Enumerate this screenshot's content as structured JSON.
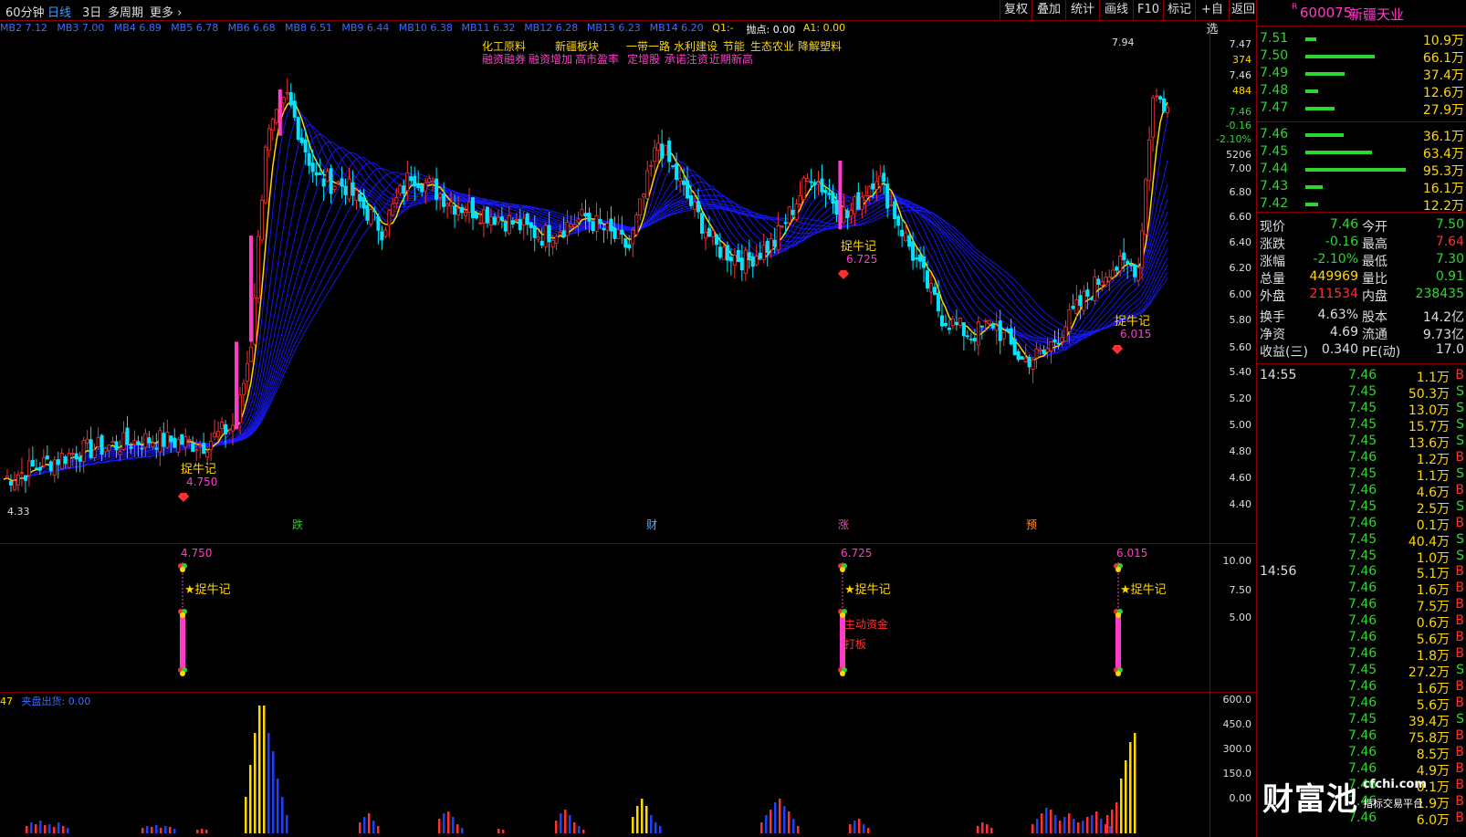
{
  "toolbar": {
    "period": "60分钟",
    "day": "日线",
    "three_day": "3日",
    "multi": "多周期",
    "more": "更多",
    "buttons": [
      "复权",
      "叠加",
      "统计",
      "画线",
      "F10",
      "标记",
      "+自选",
      "返回"
    ]
  },
  "stock": {
    "badge": "R",
    "code": "600075",
    "name": "新疆天业"
  },
  "ma_legend": [
    {
      "label": "MB2 7.12",
      "color": "#3a6cff"
    },
    {
      "label": "MB3 7.00",
      "color": "#3a6cff"
    },
    {
      "label": "MB4 6.89",
      "color": "#3a6cff"
    },
    {
      "label": "MB5 6.78",
      "color": "#3a6cff"
    },
    {
      "label": "MB6 6.68",
      "color": "#3a6cff"
    },
    {
      "label": "MB8 6.51",
      "color": "#3a6cff"
    },
    {
      "label": "MB9 6.44",
      "color": "#3a6cff"
    },
    {
      "label": "MB10 6.38",
      "color": "#3a6cff"
    },
    {
      "label": "MB11 6.32",
      "color": "#3a6cff"
    },
    {
      "label": "MB12 6.28",
      "color": "#3a6cff"
    },
    {
      "label": "MB13 6.23",
      "color": "#3a6cff"
    },
    {
      "label": "MB14 6.20",
      "color": "#3a6cff"
    },
    {
      "label": "Q1:-",
      "color": "#ffd700"
    },
    {
      "label": "抛点: 0.00",
      "color": "#ffffff"
    },
    {
      "label": "A1: 0.00",
      "color": "#ffd700"
    }
  ],
  "concepts": {
    "line1": [
      "化工原料",
      "新疆板块",
      "一带一路",
      "水利建设",
      "节能",
      "生态农业",
      "降解塑料"
    ],
    "line2": [
      "融资融券",
      "融资增加",
      "高市盈率",
      "定增股",
      "承诺注资",
      "近期新高"
    ]
  },
  "price_axis": [
    "7.47",
    "374",
    "7.46",
    "484",
    "7.46",
    "-0.16",
    "-2.10%",
    "5206",
    "7.00",
    "6.80",
    "6.60",
    "6.40",
    "6.20",
    "6.00",
    "5.80",
    "5.60",
    "5.40",
    "5.20",
    "5.00",
    "4.80",
    "4.60",
    "4.40"
  ],
  "chart_data": {
    "type": "candlestick",
    "ylim": [
      4.2,
      8.0
    ],
    "high_label": "7.94",
    "low_label": "4.33",
    "signals": [
      {
        "text": "捉牛记",
        "value": "4.750"
      },
      {
        "text": "捉牛记",
        "value": "6.725"
      },
      {
        "text": "捉牛记",
        "value": "6.015"
      }
    ],
    "event_markers": [
      "跌",
      "财",
      "涨",
      "预"
    ],
    "indicator_axis": [
      "10.00",
      "7.50",
      "5.00"
    ],
    "indicator_labels": [
      {
        "value": "4.750",
        "text": "★捉牛记"
      },
      {
        "value": "6.725",
        "text": "★捉牛记",
        "extra": [
          "主动资金",
          "打板"
        ]
      },
      {
        "value": "6.015",
        "text": "★捉牛记"
      }
    ],
    "volume_axis": [
      "600.0",
      "450.0",
      "300.0",
      "150.0",
      "0.00"
    ],
    "volume_legend": {
      "prefix": "47",
      "label": "夹盘出货: 0.00"
    }
  },
  "orderbook": [
    {
      "price": "7.51",
      "vol": "10.9万",
      "bar": 0.11
    },
    {
      "price": "7.50",
      "vol": "66.1万",
      "bar": 0.69
    },
    {
      "price": "7.49",
      "vol": "37.4万",
      "bar": 0.39
    },
    {
      "price": "7.48",
      "vol": "12.6万",
      "bar": 0.13
    },
    {
      "price": "7.47",
      "vol": "27.9万",
      "bar": 0.29
    },
    {
      "price": "7.46",
      "vol": "36.1万",
      "bar": 0.38
    },
    {
      "price": "7.45",
      "vol": "63.4万",
      "bar": 0.66
    },
    {
      "price": "7.44",
      "vol": "95.3万",
      "bar": 1.0
    },
    {
      "price": "7.43",
      "vol": "16.1万",
      "bar": 0.17
    },
    {
      "price": "7.42",
      "vol": "12.2万",
      "bar": 0.13
    }
  ],
  "quote": [
    {
      "l": "现价",
      "v": "7.46",
      "c": "#2fd62f",
      "l2": "今开",
      "v2": "7.50",
      "c2": "#2fd62f"
    },
    {
      "l": "涨跌",
      "v": "-0.16",
      "c": "#2fd62f",
      "l2": "最高",
      "v2": "7.64",
      "c2": "#ff3030"
    },
    {
      "l": "涨幅",
      "v": "-2.10%",
      "c": "#2fd62f",
      "l2": "最低",
      "v2": "7.30",
      "c2": "#2fd62f"
    },
    {
      "l": "总量",
      "v": "449969",
      "c": "#ffd700",
      "l2": "量比",
      "v2": "0.91",
      "c2": "#2fd62f"
    },
    {
      "l": "外盘",
      "v": "211534",
      "c": "#ff3030",
      "l2": "内盘",
      "v2": "238435",
      "c2": "#2fd62f"
    },
    {
      "l": "换手",
      "v": "4.63%",
      "c": "#ddd",
      "l2": "股本",
      "v2": "14.2亿",
      "c2": "#ddd"
    },
    {
      "l": "净资",
      "v": "4.69",
      "c": "#ddd",
      "l2": "流通",
      "v2": "9.73亿",
      "c2": "#ddd"
    },
    {
      "l": "收益(三)",
      "v": "0.340",
      "c": "#ddd",
      "l2": "PE(动)",
      "v2": "17.0",
      "c2": "#ddd"
    }
  ],
  "ticks_a": {
    "time": "14:55",
    "rows": [
      [
        "7.46",
        "1.1万",
        "B"
      ],
      [
        "7.45",
        "50.3万",
        "S"
      ],
      [
        "7.45",
        "13.0万",
        "S"
      ],
      [
        "7.45",
        "15.7万",
        "S"
      ],
      [
        "7.45",
        "13.6万",
        "S"
      ],
      [
        "7.46",
        "1.2万",
        "B"
      ],
      [
        "7.45",
        "1.1万",
        "S"
      ],
      [
        "7.46",
        "4.6万",
        "B"
      ],
      [
        "7.45",
        "2.5万",
        "S"
      ],
      [
        "7.46",
        "0.1万",
        "B"
      ],
      [
        "7.45",
        "40.4万",
        "S"
      ],
      [
        "7.45",
        "1.0万",
        "S"
      ]
    ]
  },
  "ticks_b": {
    "time": "14:56",
    "rows": [
      [
        "7.46",
        "5.1万",
        "B"
      ],
      [
        "7.46",
        "1.6万",
        "B"
      ],
      [
        "7.46",
        "7.5万",
        "B"
      ],
      [
        "7.46",
        "0.6万",
        "B"
      ],
      [
        "7.46",
        "5.6万",
        "B"
      ],
      [
        "7.46",
        "1.8万",
        "B"
      ],
      [
        "7.45",
        "27.2万",
        "S"
      ],
      [
        "7.46",
        "1.6万",
        "B"
      ],
      [
        "7.46",
        "5.6万",
        "B"
      ],
      [
        "7.45",
        "39.4万",
        "S"
      ],
      [
        "7.46",
        "75.8万",
        "B"
      ],
      [
        "7.46",
        "8.5万",
        "B"
      ],
      [
        "7.46",
        "4.9万",
        "B"
      ],
      [
        "7.46",
        "0.1万",
        "B"
      ],
      [
        "7.46",
        "1.9万",
        "B"
      ],
      [
        "7.46",
        "6.0万",
        "B"
      ]
    ]
  },
  "watermark": {
    "brand": "财富池",
    "site": "cfchi.com",
    "sub": "指标交易平台"
  },
  "colors": {
    "up": "#ff3030",
    "down": "#00e5ff",
    "ribbon": "#1a1aff",
    "yellow": "#ffd700",
    "magenta": "#ff3cc8",
    "frame": "#8a0000"
  }
}
